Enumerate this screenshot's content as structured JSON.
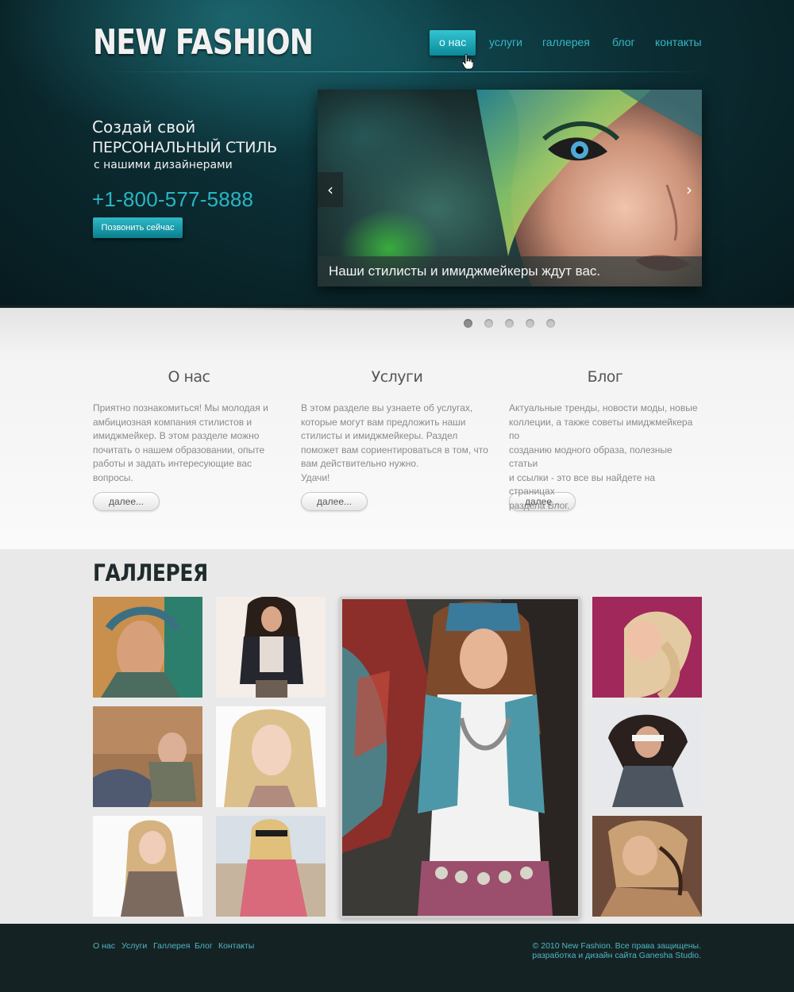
{
  "header": {
    "logo": "NEW FASHION",
    "nav": [
      {
        "label": "о нас",
        "active": true
      },
      {
        "label": "услуги",
        "active": false
      },
      {
        "label": "галлерея",
        "active": false
      },
      {
        "label": "блог",
        "active": false
      },
      {
        "label": "контакты",
        "active": false
      }
    ]
  },
  "promo": {
    "line1": "Создай свой",
    "line2": "ПЕРСОНАЛЬНЫЙ СТИЛЬ",
    "line3": "с нашими дизайнерами",
    "phone": "+1-800-577-5888",
    "call_button": "Позвонить сейчас"
  },
  "slider": {
    "caption": "Наши стилисты и имиджмейкеры ждут вас.",
    "prev_icon": "‹",
    "next_icon": "›",
    "slides_count": 5,
    "active_slide": 1
  },
  "features": [
    {
      "title": "О нас",
      "text": "Приятно познакомиться! Мы молодая и\nамбициозная компания стилистов и\nимиджмейкер. В этом разделе можно\nпочитать о нашем образовании, опыте\nработы и задать интересующие вас\nвопросы.",
      "button": "далее..."
    },
    {
      "title": "Услуги",
      "text": "В этом разделе вы узнаете об услугах,\nкоторые могут вам предложить наши\nстилисты и имиджмейкеры. Раздел\nпоможет вам сориентироваться в том, что\nвам действительно нужно.\nУдачи!",
      "button": "далее..."
    },
    {
      "title": "Блог",
      "text": "Актуальные тренды, новости  моды, новые\nколлеции, а также советы имиджмейкера по\nсозданию модного образа, полезные статьи\nи ссылки - это все вы найдете на страницах\nраздела Блог.",
      "button": "далее..."
    }
  ],
  "gallery": {
    "title": "ГАЛЛЕРЕЯ"
  },
  "footer": {
    "links": [
      "О нас",
      "Услуги",
      "Галлерея",
      "Блог",
      "Контакты"
    ],
    "copyright_line1": "© 2010 New Fashion. Все права защищены.",
    "copyright_line2": "разработка и дизайн сайта Ganesha Studio."
  },
  "colors": {
    "accent": "#2ab5c4",
    "header_bg": "#0b2d33",
    "footer_bg": "#152224"
  }
}
